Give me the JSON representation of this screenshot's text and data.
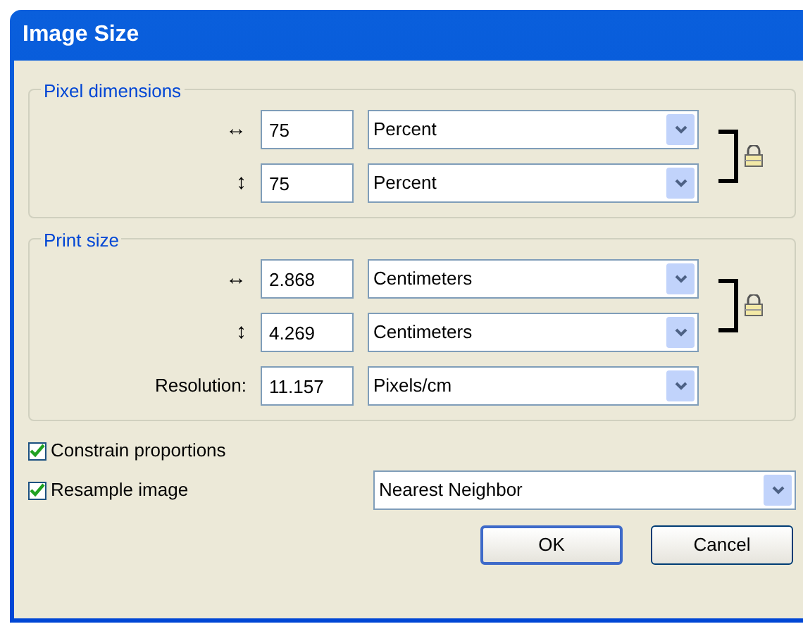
{
  "window": {
    "title": "Image Size"
  },
  "groups": [
    {
      "legend": "Pixel dimensions",
      "linked": true,
      "rows": [
        {
          "label": "↔",
          "value": "75",
          "unit": "Percent"
        },
        {
          "label": "↕",
          "value": "75",
          "unit": "Percent"
        }
      ]
    },
    {
      "legend": "Print size",
      "linked": true,
      "rows": [
        {
          "label": "↔",
          "value": "2.868",
          "unit": "Centimeters"
        },
        {
          "label": "↕",
          "value": "4.269",
          "unit": "Centimeters"
        },
        {
          "label": "Resolution:",
          "value": "11.157",
          "unit": "Pixels/cm"
        }
      ]
    }
  ],
  "checkboxes": [
    {
      "label": "Constrain proportions",
      "checked": true
    },
    {
      "label": "Resample image",
      "checked": true
    }
  ],
  "resample_method": "Nearest Neighbor",
  "buttons": [
    {
      "label": "OK",
      "default": true
    },
    {
      "label": "Cancel",
      "default": false
    }
  ]
}
